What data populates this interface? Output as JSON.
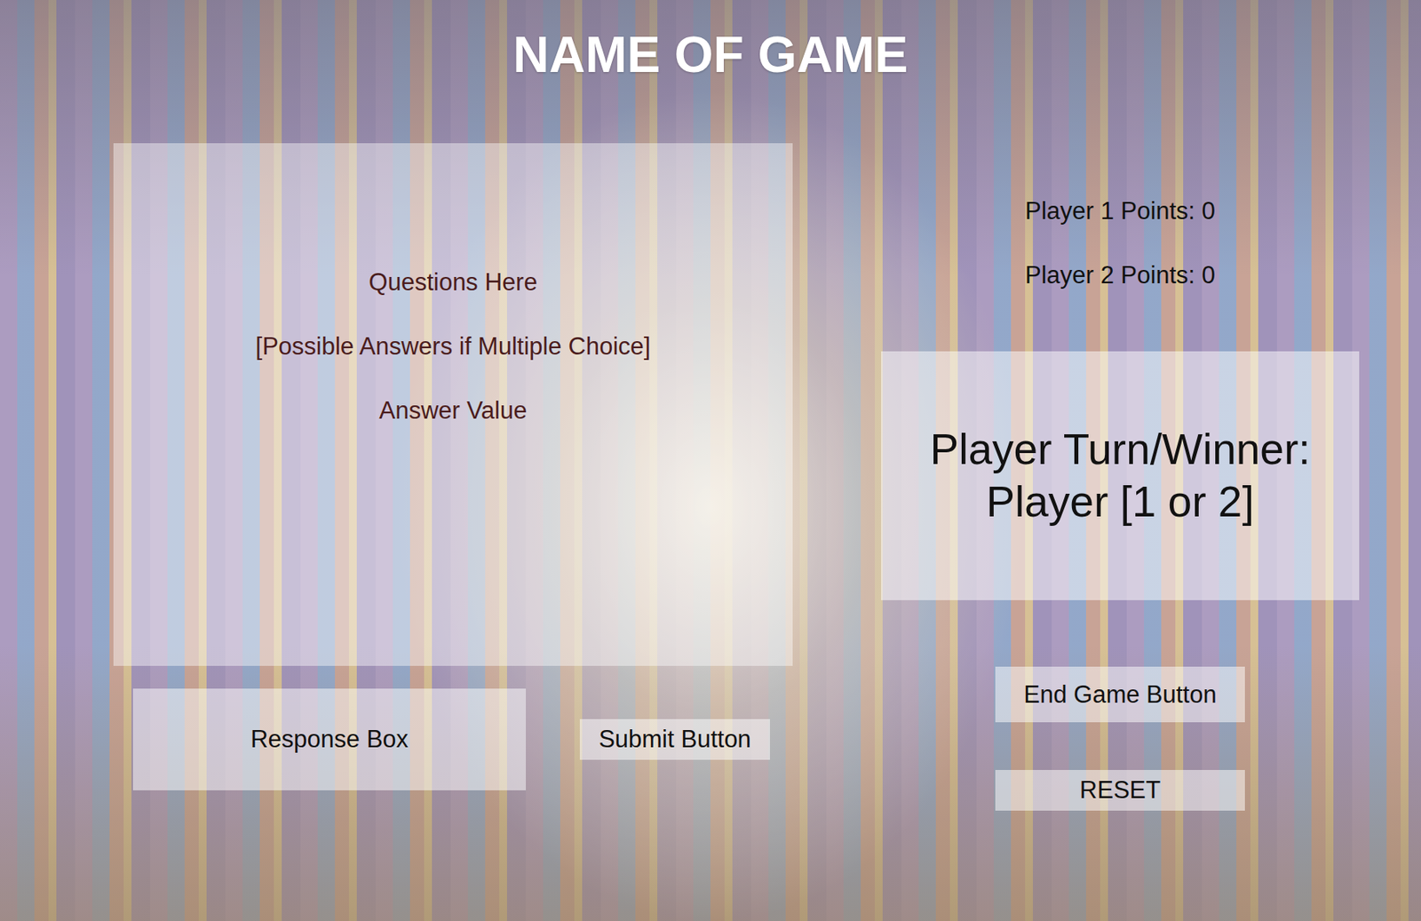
{
  "title": "NAME OF GAME",
  "question_panel": {
    "question": "Questions Here",
    "choices": "[Possible Answers if Multiple Choice]",
    "answer_value": "Answer Value"
  },
  "response_box": {
    "text": "Response Box"
  },
  "submit_button": "Submit Button",
  "scores": [
    {
      "label": "Player 1 Points: 0"
    },
    {
      "label": "Player 2 Points: 0"
    }
  ],
  "turn_panel": {
    "lines": [
      "Player Turn/Winner:",
      "Player [1 or 2]"
    ]
  },
  "buttons": [
    "End Game Button",
    "RESET"
  ]
}
